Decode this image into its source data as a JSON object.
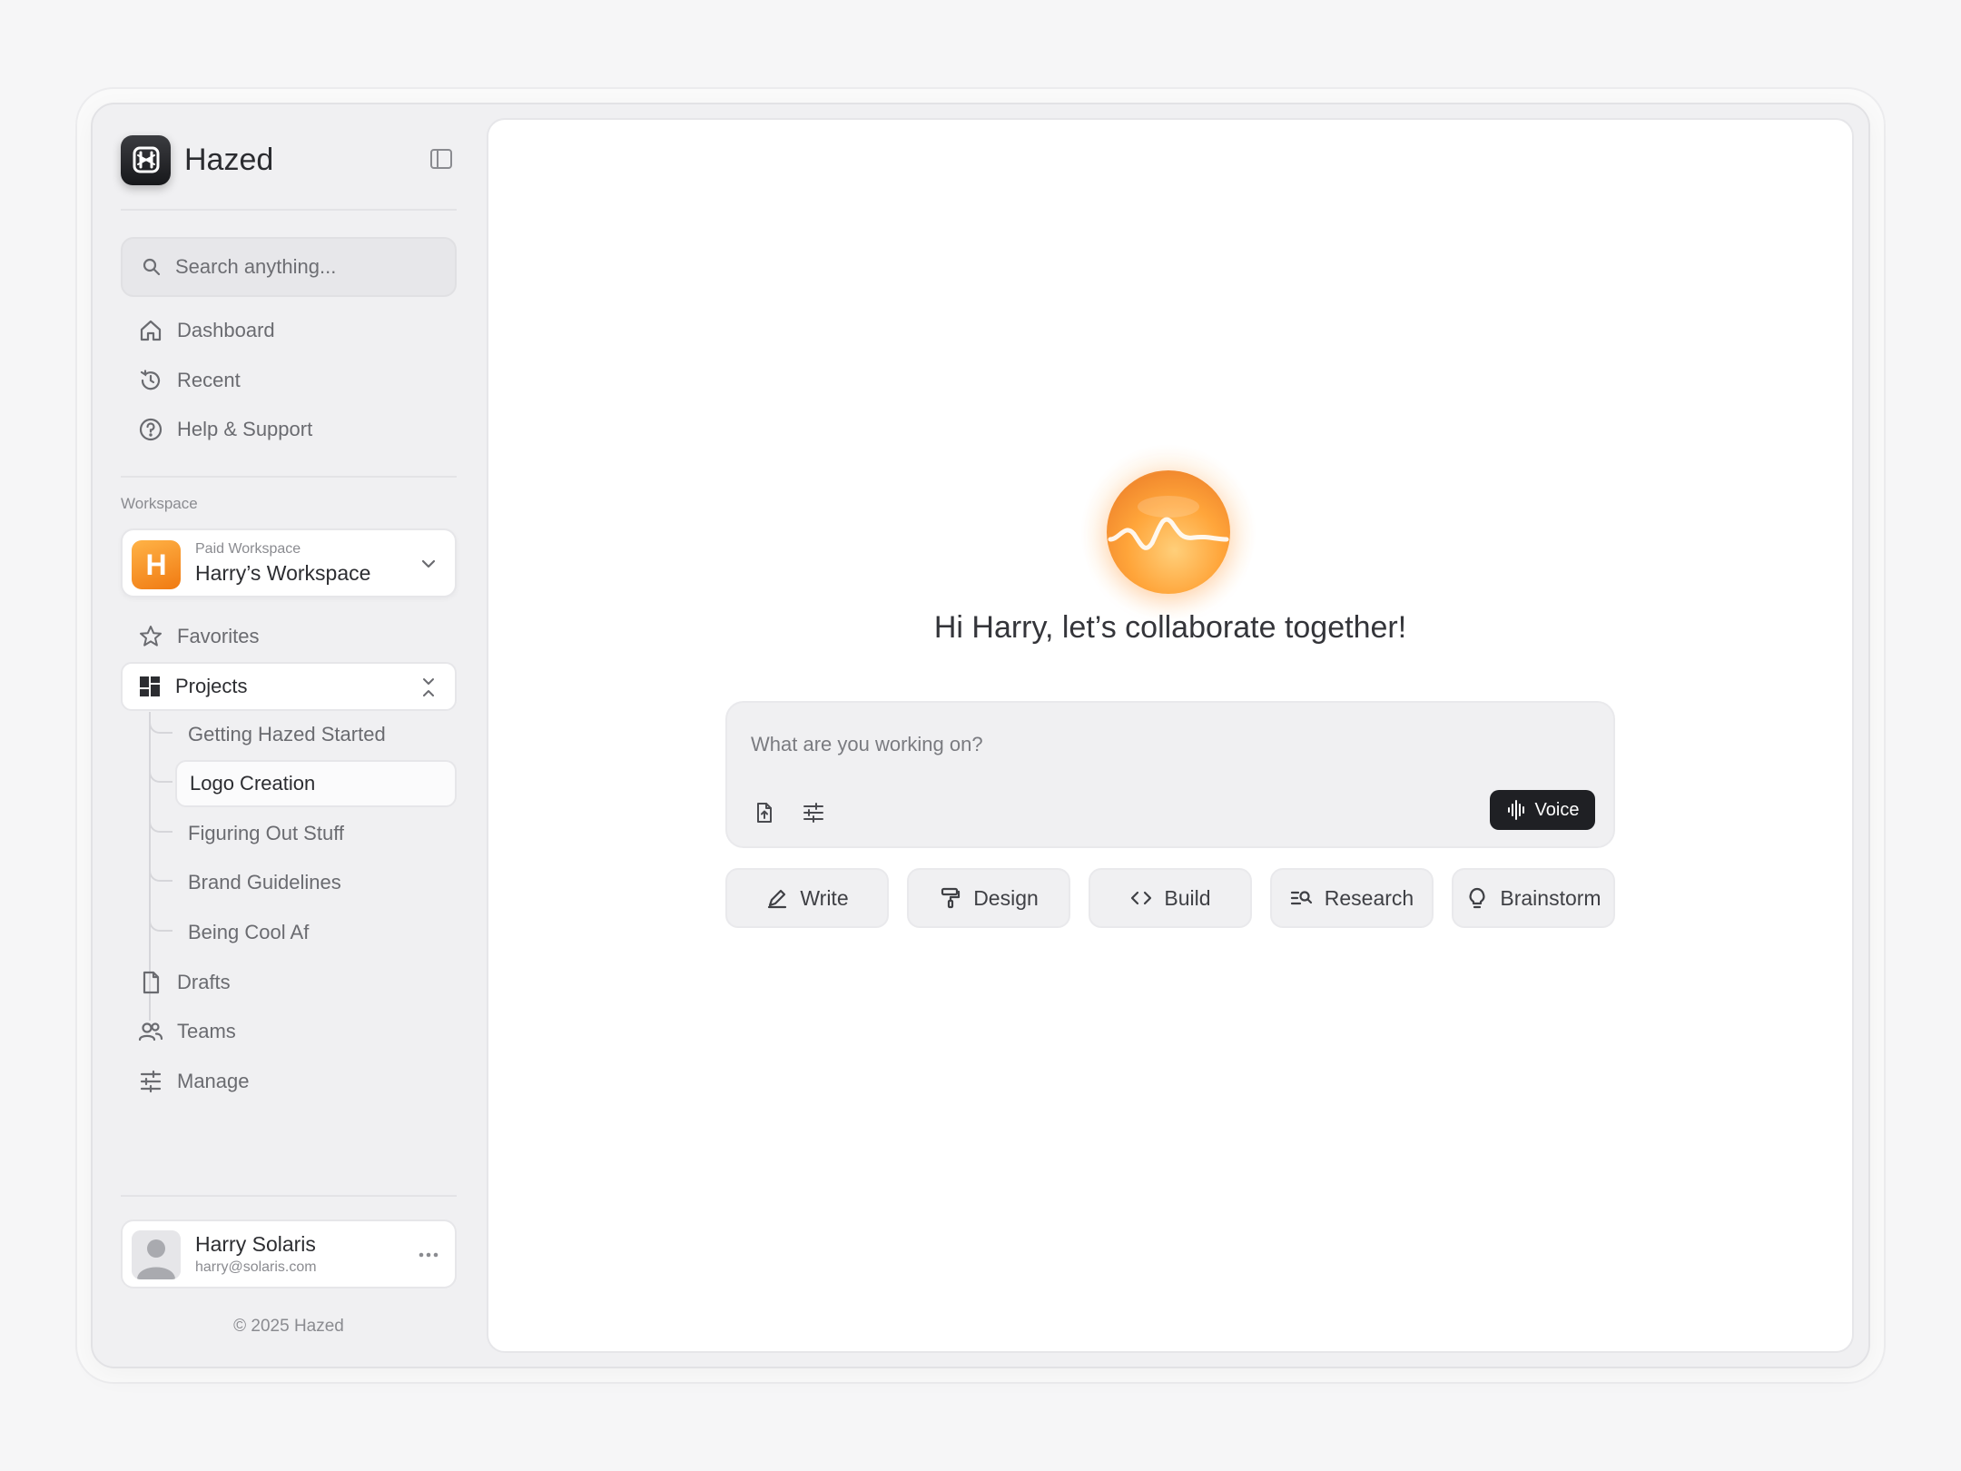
{
  "app": {
    "name": "Hazed"
  },
  "search": {
    "placeholder": "Search anything..."
  },
  "nav": {
    "primary": [
      {
        "label": "Dashboard",
        "icon": "home-icon"
      },
      {
        "label": "Recent",
        "icon": "history-icon"
      },
      {
        "label": "Help & Support",
        "icon": "help-icon"
      }
    ]
  },
  "workspace": {
    "section_label": "Workspace",
    "avatar_letter": "H",
    "tier": "Paid Workspace",
    "name": "Harry’s Workspace"
  },
  "favorites": {
    "label": "Favorites"
  },
  "projects": {
    "label": "Projects",
    "items": [
      {
        "label": "Getting Hazed Started",
        "active": false
      },
      {
        "label": "Logo Creation",
        "active": true
      },
      {
        "label": "Figuring Out Stuff",
        "active": false
      },
      {
        "label": "Brand Guidelines",
        "active": false
      },
      {
        "label": "Being Cool Af",
        "active": false
      }
    ]
  },
  "nav_secondary": [
    {
      "label": "Drafts",
      "icon": "file-icon"
    },
    {
      "label": "Teams",
      "icon": "users-icon"
    },
    {
      "label": "Manage",
      "icon": "sliders-icon"
    }
  ],
  "user": {
    "name": "Harry Solaris",
    "email": "harry@solaris.com"
  },
  "footer": {
    "copyright": "© 2025 Hazed"
  },
  "main": {
    "greeting": "Hi Harry, let’s collaborate together!",
    "prompt_placeholder": "What are you working on?",
    "voice_label": "Voice",
    "chips": [
      {
        "label": "Write",
        "icon": "pen-icon"
      },
      {
        "label": "Design",
        "icon": "paint-roller-icon"
      },
      {
        "label": "Build",
        "icon": "code-icon"
      },
      {
        "label": "Research",
        "icon": "text-search-icon"
      },
      {
        "label": "Brainstorm",
        "icon": "lightbulb-icon"
      }
    ]
  },
  "colors": {
    "accent_orange": "#f28a2e",
    "voice_button": "#1f2024",
    "panel_bg": "#ffffff",
    "sidebar_bg": "#f0f0f2"
  }
}
